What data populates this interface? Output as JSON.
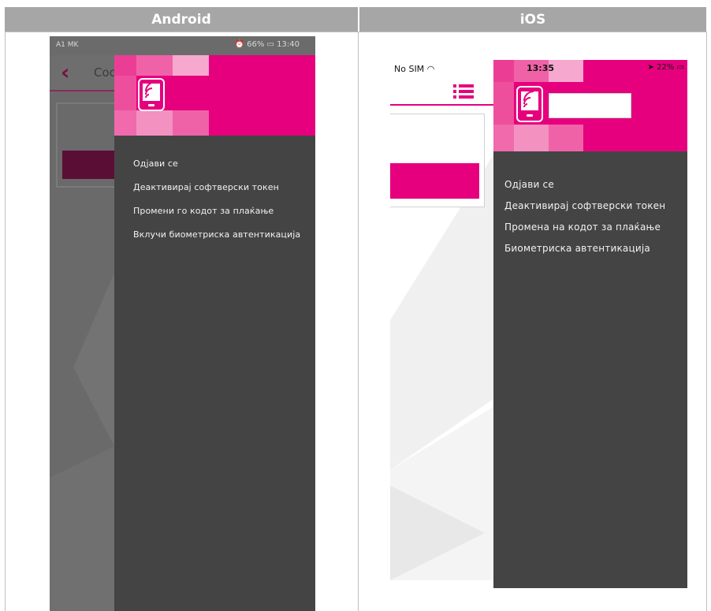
{
  "columns": {
    "android": "Android",
    "ios": "iOS"
  },
  "android": {
    "status": {
      "carrier": "A1 MK",
      "indicators": "66%",
      "time": "13:40"
    },
    "appbar": {
      "back_icon": "chevron-left-icon",
      "title_fragment": "Coc"
    },
    "drawer": {
      "menu": [
        "Одјави се",
        "Деактивирај софтверски токен",
        "Промени го кодот за плаќање",
        "Вклучи биометриска автентикација"
      ]
    }
  },
  "ios": {
    "status": {
      "carrier": "No SIM",
      "time": "13:35",
      "battery": "22%"
    },
    "drawer": {
      "menu": [
        "Одјави се",
        "Деактивирај софтверски токен",
        "Промена на кодот за плаќање",
        "Биометриска автентикација"
      ]
    }
  },
  "colors": {
    "brand": "#e6007e",
    "drawer_bg": "#444444",
    "header_gray": "#a6a6a6"
  }
}
